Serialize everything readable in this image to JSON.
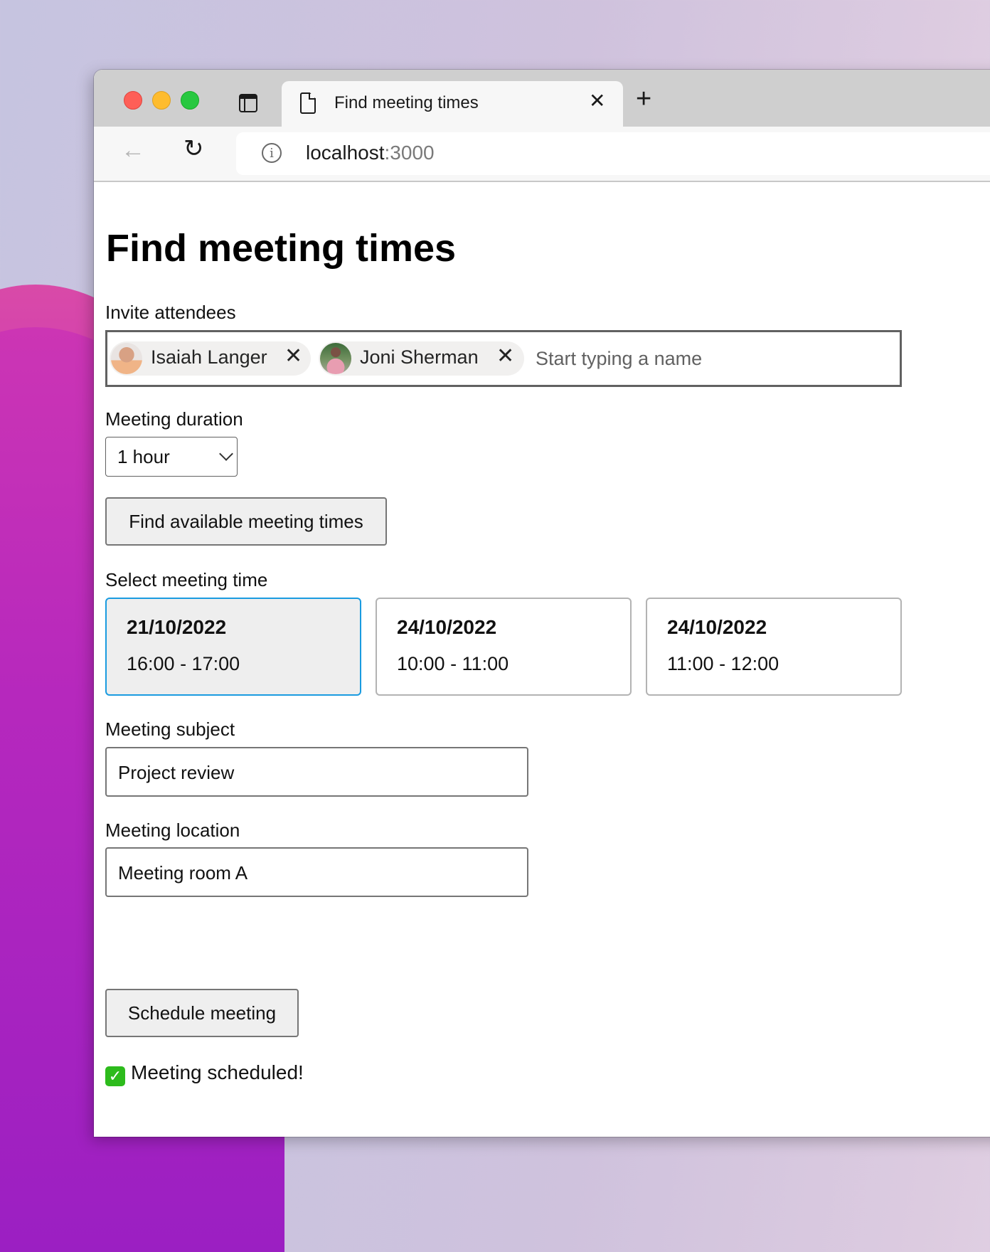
{
  "browser": {
    "tab_title": "Find meeting times",
    "tab_close_glyph": "✕",
    "new_tab_glyph": "+",
    "back_glyph": "←",
    "reload_glyph": "↻",
    "info_glyph": "i",
    "url_host": "localhost",
    "url_port": ":3000"
  },
  "page": {
    "title": "Find meeting times",
    "attendees": {
      "label": "Invite attendees",
      "people": [
        {
          "name": "Isaiah Langer",
          "remove_glyph": "✕"
        },
        {
          "name": "Joni Sherman",
          "remove_glyph": "✕"
        }
      ],
      "placeholder": "Start typing a name"
    },
    "duration": {
      "label": "Meeting duration",
      "selected": "1 hour"
    },
    "find_button": "Find available meeting times",
    "slots": {
      "label": "Select meeting time",
      "items": [
        {
          "date": "21/10/2022",
          "time": "16:00 - 17:00",
          "selected": true
        },
        {
          "date": "24/10/2022",
          "time": "10:00 - 11:00",
          "selected": false
        },
        {
          "date": "24/10/2022",
          "time": "11:00 - 12:00",
          "selected": false
        }
      ]
    },
    "subject": {
      "label": "Meeting subject",
      "value": "Project review"
    },
    "location": {
      "label": "Meeting location",
      "value": "Meeting room A"
    },
    "schedule_button": "Schedule meeting",
    "status": {
      "check_glyph": "✓",
      "text": "Meeting scheduled!"
    }
  },
  "colors": {
    "selected_slot_border": "#1a9be0",
    "status_check": "#2dbb1c"
  }
}
